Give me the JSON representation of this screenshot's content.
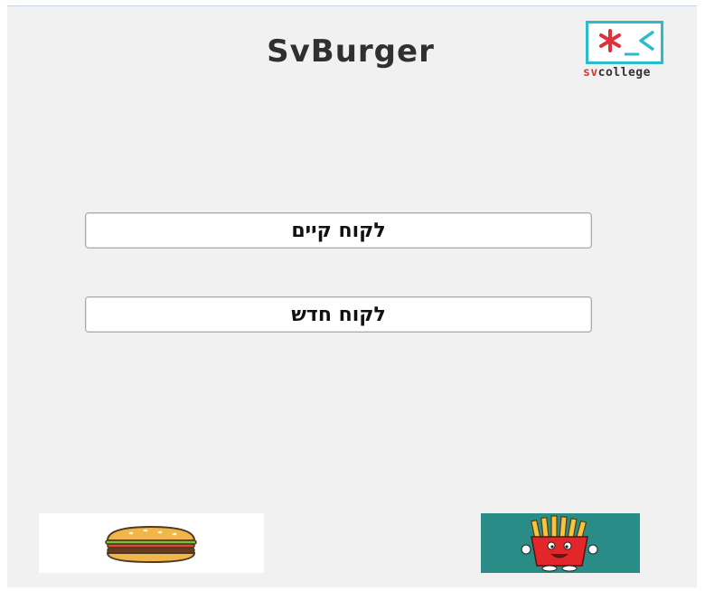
{
  "header": {
    "title": "SvBurger"
  },
  "logo": {
    "text_sv": "sv",
    "text_college": "college"
  },
  "buttons": {
    "existing_customer": "לקוח קיים",
    "new_customer": "לקוח חדש"
  },
  "images": {
    "left": "burger-icon",
    "right": "fries-icon"
  },
  "colors": {
    "logo_teal": "#2bbccc",
    "logo_red": "#d63a3a",
    "fries_bg": "#2a8c86"
  }
}
